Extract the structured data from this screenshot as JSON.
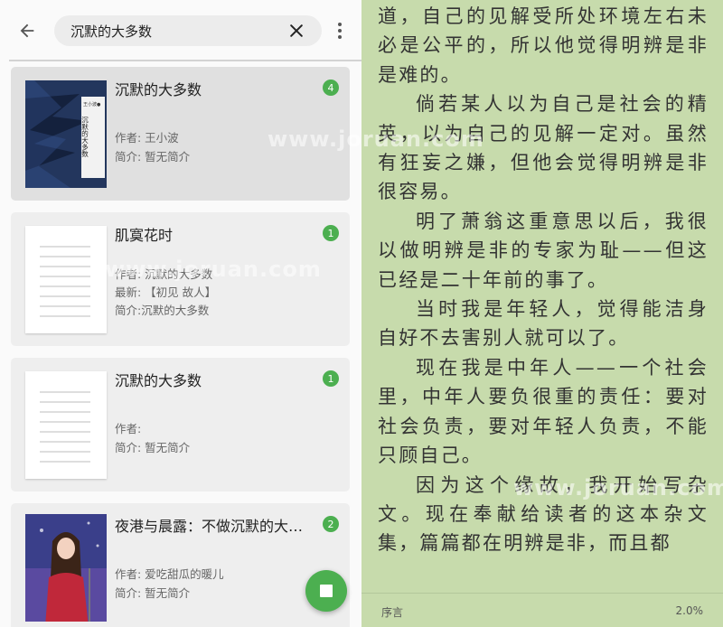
{
  "search": {
    "query": "沉默的大多数"
  },
  "results": [
    {
      "title": "沉默的大多数",
      "author": "作者: 王小波",
      "latest": "",
      "intro": "简介: 暂无简介",
      "badge": "4",
      "cover_text": {
        "top": "王小波●",
        "main": "沉默的大多数"
      }
    },
    {
      "title": "肌寞花时",
      "author": "作者: 沉默的大多数",
      "latest": "最新: 【初见 故人】",
      "intro": "简介:沉默的大多数",
      "badge": "1"
    },
    {
      "title": "沉默的大多数",
      "author": "作者:",
      "latest": "",
      "intro": "简介: 暂无简介",
      "badge": "1"
    },
    {
      "title": "夜港与晨露：不做沉默的大多数",
      "author": "作者: 爱吃甜瓜的暖儿",
      "latest": "",
      "intro": "简介: 暂无简介",
      "badge": "2"
    }
  ],
  "reader": {
    "paragraphs": [
      "道，自己的见解受所处环境左右未必是公平的，所以他觉得明辨是非是难的。",
      "倘若某人以为自己是社会的精英，以为自己的见解一定对。虽然有狂妄之嫌，但他会觉得明辨是非很容易。",
      "明了萧翁这重意思以后，我很以做明辨是非的专家为耻——但这已经是二十年前的事了。",
      "当时我是年轻人，觉得能洁身自好不去害别人就可以了。",
      "现在我是中年人——一个社会里，中年人要负很重的责任：要对社会负责，要对年轻人负责，不能只顾自己。",
      "因为这个缘故，我开始写杂文。现在奉献给读者的这本杂文集，篇篇都在明辨是非，而且都"
    ],
    "chapter": "序言",
    "progress": "2.0%"
  },
  "watermark": "www.joruan.com",
  "colors": {
    "accent_green": "#4caf50",
    "reader_bg": "#c7dbac"
  },
  "icons": {
    "back": "arrow-left-icon",
    "clear": "close-icon",
    "more": "more-vert-icon",
    "fab": "stop-icon"
  }
}
